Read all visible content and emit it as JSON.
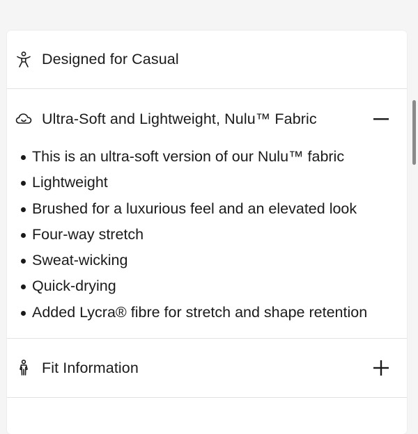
{
  "sections": [
    {
      "title": "Designed for Casual",
      "icon": "casual-person-icon"
    },
    {
      "title": "Ultra-Soft and Lightweight, Nulu™ Fabric",
      "icon": "cloud-icon",
      "toggle_icon": "minus-icon",
      "expanded": true,
      "bullets": [
        "This is an ultra-soft version of our Nulu™ fabric",
        "Lightweight",
        "Brushed for a luxurious feel and an elevated look",
        "Four-way stretch",
        "Sweat-wicking",
        "Quick-drying",
        "Added Lycra® fibre for stretch and shape retention"
      ]
    },
    {
      "title": "Fit Information",
      "icon": "fit-person-icon",
      "toggle_icon": "plus-icon",
      "expanded": false
    }
  ]
}
